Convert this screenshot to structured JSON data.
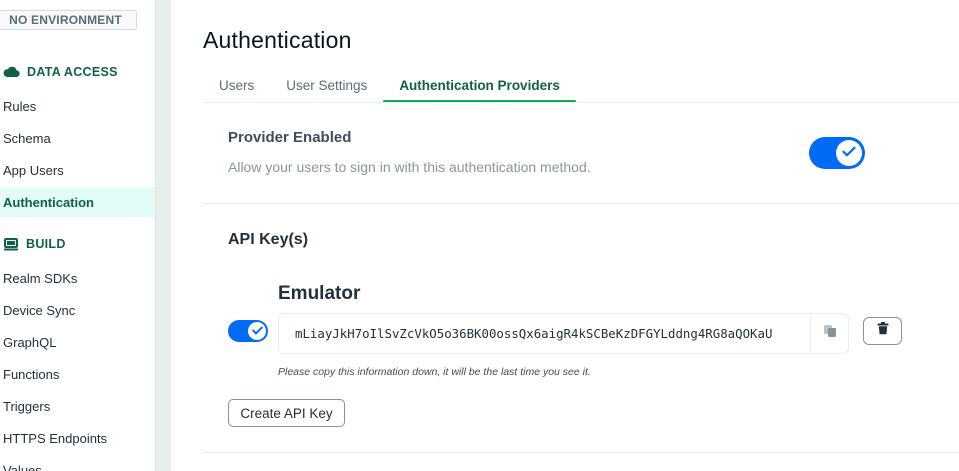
{
  "sidebar": {
    "environment_badge": "NO ENVIRONMENT",
    "data_access": {
      "heading": "DATA ACCESS",
      "items": [
        {
          "label": "Rules"
        },
        {
          "label": "Schema"
        },
        {
          "label": "App Users"
        },
        {
          "label": "Authentication",
          "active": true
        }
      ]
    },
    "build": {
      "heading": "BUILD",
      "items": [
        {
          "label": "Realm SDKs"
        },
        {
          "label": "Device Sync"
        },
        {
          "label": "GraphQL"
        },
        {
          "label": "Functions"
        },
        {
          "label": "Triggers"
        },
        {
          "label": "HTTPS Endpoints"
        },
        {
          "label": "Values"
        }
      ]
    }
  },
  "main": {
    "title": "Authentication",
    "tabs": [
      {
        "label": "Users"
      },
      {
        "label": "User Settings"
      },
      {
        "label": "Authentication Providers",
        "active": true
      }
    ],
    "provider": {
      "title": "Provider Enabled",
      "description": "Allow your users to sign in with this authentication method.",
      "enabled": true
    },
    "api_keys": {
      "title": "API Key(s)",
      "key": {
        "name": "Emulator",
        "enabled": true,
        "value": "mLiayJkH7oIlSvZcVkO5o36BK00ossQx6aigR4kSCBeKzDFGYLddng4RG8aQOKaU",
        "note": "Please copy this information down, it will be the last time you see it."
      },
      "create_button": "Create API Key"
    }
  },
  "colors": {
    "accent_green": "#116149",
    "tab_underline": "#13aa52",
    "toggle_blue": "#016bf8",
    "active_nav_bg": "#e3fcf7"
  }
}
